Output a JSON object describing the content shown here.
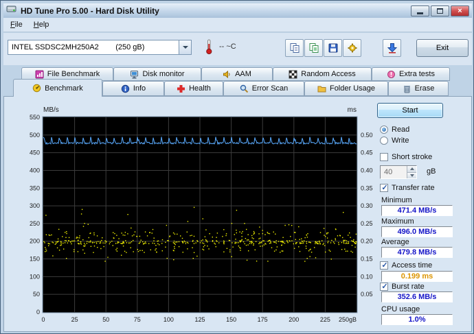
{
  "window": {
    "title": "HD Tune Pro 5.00 - Hard Disk Utility"
  },
  "menu": {
    "file": "File",
    "help": "Help"
  },
  "toolbar": {
    "drive_select": "INTEL SSDSC2MH250A2        (250 gB)",
    "temperature": "-- ~C",
    "exit_label": "Exit",
    "icons": [
      "thermometer-icon",
      "copy-text-icon",
      "copy-image-icon",
      "save-icon",
      "options-gear-icon",
      "save-screenshot-icon",
      "chevron-down-icon"
    ]
  },
  "tabs": {
    "row1": [
      {
        "label": "File Benchmark",
        "icon": "file-benchmark-icon"
      },
      {
        "label": "Disk monitor",
        "icon": "disk-monitor-icon"
      },
      {
        "label": "AAM",
        "icon": "aam-speaker-icon"
      },
      {
        "label": "Random Access",
        "icon": "random-access-icon"
      },
      {
        "label": "Extra tests",
        "icon": "extra-tests-icon"
      }
    ],
    "row2": [
      {
        "label": "Benchmark",
        "icon": "benchmark-gauge-icon",
        "active": true
      },
      {
        "label": "Info",
        "icon": "info-icon"
      },
      {
        "label": "Health",
        "icon": "health-cross-icon"
      },
      {
        "label": "Error Scan",
        "icon": "error-scan-magnifier-icon"
      },
      {
        "label": "Folder Usage",
        "icon": "folder-usage-icon"
      },
      {
        "label": "Erase",
        "icon": "erase-trash-icon"
      }
    ]
  },
  "controls": {
    "start_label": "Start",
    "read_label": "Read",
    "write_label": "Write",
    "short_stroke_label": "Short stroke",
    "short_stroke_value": "40",
    "short_stroke_unit": "gB",
    "transfer_rate_label": "Transfer rate",
    "minimum_label": "Minimum",
    "minimum_value": "471.4 MB/s",
    "maximum_label": "Maximum",
    "maximum_value": "496.0 MB/s",
    "average_label": "Average",
    "average_value": "479.8 MB/s",
    "access_time_label": "Access time",
    "access_time_value": "0.199 ms",
    "burst_rate_label": "Burst rate",
    "burst_rate_value": "352.6 MB/s",
    "cpu_usage_label": "CPU usage",
    "cpu_usage_value": "1.0%"
  },
  "colors": {
    "value_blue": "#1414c8",
    "value_orange": "#dc9400",
    "transfer_line": "#5aabff",
    "access_dots": "#f2f200",
    "chart_bg": "#000000",
    "grid": "#3c3c3c"
  },
  "chart_data": {
    "type": "line+scatter",
    "title": "",
    "y_left_label": "MB/s",
    "y_right_label": "ms",
    "y_left_ticks": [
      0,
      50,
      100,
      150,
      200,
      250,
      300,
      350,
      400,
      450,
      500,
      550
    ],
    "y_left_max": 550,
    "y_right_ticks": [
      "0.05",
      "0.10",
      "0.15",
      "0.20",
      "0.25",
      "0.30",
      "0.35",
      "0.40",
      "0.45",
      "0.50"
    ],
    "y_right_max": 0.55,
    "x_ticks": [
      0,
      25,
      50,
      75,
      100,
      125,
      150,
      175,
      200,
      225,
      250
    ],
    "x_max": 250,
    "x_max_label": "250gB",
    "grid": true,
    "series": [
      {
        "name": "transfer-rate",
        "type": "line",
        "color": "#5aabff",
        "unit": "MB/s",
        "baseline_mbs": 477,
        "spike_mbs": 496,
        "spike_count": 40,
        "min": 471.4,
        "max": 496.0,
        "avg": 479.8
      },
      {
        "name": "access-time",
        "type": "scatter",
        "color": "#f2f200",
        "unit": "ms",
        "avg_ms": 0.199,
        "band_min_ms": 0.14,
        "band_max_ms": 0.3,
        "points": 560
      }
    ]
  }
}
